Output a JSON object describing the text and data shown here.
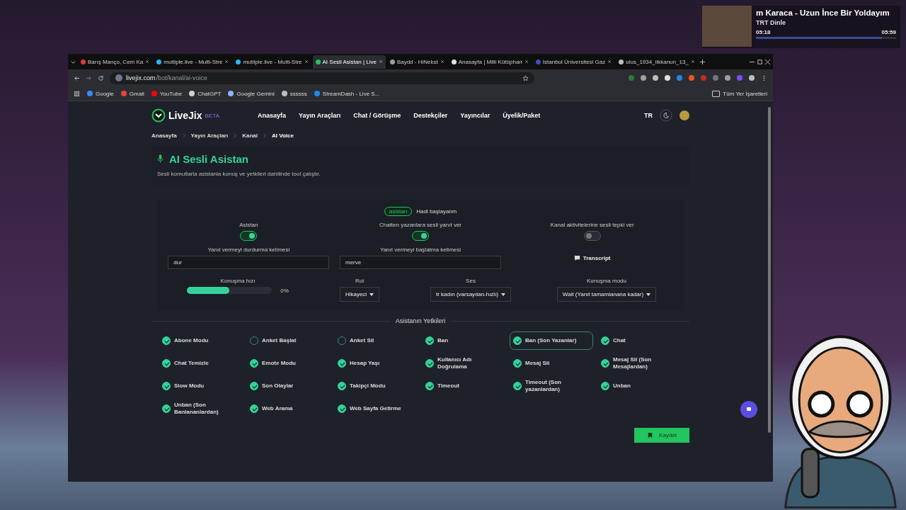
{
  "music": {
    "title": "m Karaca - Uzun İnce Bir Yoldayım",
    "source": "TRT Dinle",
    "elapsed": "05:18",
    "duration": "05:59",
    "level": 0.9
  },
  "browser": {
    "tabs": [
      {
        "title": "Barış Manço, Cem Ka",
        "selected": false,
        "color": "#e53935"
      },
      {
        "title": "mutliple.live - Multi-Stre",
        "selected": false,
        "color": "#29b6f6"
      },
      {
        "title": "mutliple.live - Multi-Stre",
        "selected": false,
        "color": "#29b6f6"
      },
      {
        "title": "AI Sesli Asistan | Live",
        "selected": true,
        "color": "#22c55e"
      },
      {
        "title": "Baydd - HiNekst",
        "selected": false,
        "color": "#9e9e9e"
      },
      {
        "title": "Anasayfa | Milli Kütüphan",
        "selected": false,
        "color": "#e0e0e0"
      },
      {
        "title": "İstanbul Üniversitesi Gaz",
        "selected": false,
        "color": "#3f51b5"
      },
      {
        "title": "ulus_1934_ilkkanun_13_",
        "selected": false,
        "color": "#bdbdbd"
      }
    ],
    "url_host": "livejix.com",
    "url_path": "/bot/kanal/ai-voice",
    "bookmarks": [
      {
        "label": "Google",
        "color": "#4285f4"
      },
      {
        "label": "Gmail",
        "color": "#ea4335"
      },
      {
        "label": "YouTube",
        "color": "#ff0000"
      },
      {
        "label": "ChatGPT",
        "color": "#cfcfcf"
      },
      {
        "label": "Google Gemini",
        "color": "#8ab4f8"
      },
      {
        "label": "ssssss",
        "color": "#bdbdbd"
      },
      {
        "label": "StreamDash - Live S...",
        "color": "#1e88e5"
      }
    ],
    "all_bookmarks": "Tüm Yer İşaretleri"
  },
  "site": {
    "logo": "LiveJix",
    "badge": "BETA",
    "nav": [
      "Anasayfa",
      "Yayın Araçları",
      "Chat / Görüşme",
      "Destekçiler",
      "Yayıncılar",
      "Üyelik/Paket"
    ],
    "lang": "TR"
  },
  "breadcrumb": [
    "Anasayfa",
    "Yayın Araçları",
    "Kanal",
    "AI Voice"
  ],
  "header": {
    "title": "AI Sesli Asistan",
    "subtitle": "Sesli komutlarla asistanla konuş ve yetkileri dahilinde tool çalıştır."
  },
  "settings": {
    "status_badge": "asistan",
    "status_text": "Hadi başlayalım",
    "toggles": [
      {
        "label": "Asistan",
        "on": true
      },
      {
        "label": "Chatten yazanlara sesli yanıt ver",
        "on": true
      },
      {
        "label": "Kanal aktivitelerine sesli tepki ver",
        "on": false
      }
    ],
    "fields": [
      {
        "label": "Yanıt vermeyi durdurma kelimesi",
        "value": "dur"
      },
      {
        "label": "Yanıt vermeyi başlatma kelimesi",
        "value": "merve"
      }
    ],
    "transcript": "Transcript",
    "speed": {
      "label": "Konuşma hızı",
      "level": 0.5,
      "reading": "0%"
    },
    "selects": [
      {
        "label": "Rol",
        "value": "Hikayeci"
      },
      {
        "label": "Ses",
        "value": "tr kadın (varsayılan-hızlı)"
      },
      {
        "label": "Konuşma modu",
        "value": "Wait (Yanıt tamamlanana kadar)"
      }
    ]
  },
  "permissions": {
    "title": "Asistanın Yetkileri",
    "items": [
      {
        "label": "Abone Modu",
        "checked": true,
        "selected": false
      },
      {
        "label": "Anket Başlat",
        "checked": false,
        "selected": false
      },
      {
        "label": "Anket Sil",
        "checked": false,
        "selected": false
      },
      {
        "label": "Ban",
        "checked": true,
        "selected": false
      },
      {
        "label": "Ban (Son Yazanlar)",
        "checked": true,
        "selected": true
      },
      {
        "label": "Chat",
        "checked": true,
        "selected": false
      },
      {
        "label": "Chat Temizle",
        "checked": true,
        "selected": false
      },
      {
        "label": "Emote Modu",
        "checked": true,
        "selected": false
      },
      {
        "label": "Hesap Yaşı",
        "checked": true,
        "selected": false
      },
      {
        "label": "Kullanıcı Adı Doğrulama",
        "checked": true,
        "selected": false
      },
      {
        "label": "Mesaj Sil",
        "checked": true,
        "selected": false
      },
      {
        "label": "Mesaj Sil (Son Mesajlardan)",
        "checked": true,
        "selected": false
      },
      {
        "label": "Slow Modu",
        "checked": true,
        "selected": false
      },
      {
        "label": "Son Olaylar",
        "checked": true,
        "selected": false
      },
      {
        "label": "Takipçi Modu",
        "checked": true,
        "selected": false
      },
      {
        "label": "Timeout",
        "checked": true,
        "selected": false
      },
      {
        "label": "Timeout (Son yazanlardan)",
        "checked": true,
        "selected": false
      },
      {
        "label": "Unban",
        "checked": true,
        "selected": false
      },
      {
        "label": "Unban (Son Banlananlardan)",
        "checked": true,
        "selected": false
      },
      {
        "label": "Web Arama",
        "checked": true,
        "selected": false
      },
      {
        "label": "Web Sayfa Getirme",
        "checked": true,
        "selected": false
      }
    ]
  },
  "save": "Kaydet"
}
